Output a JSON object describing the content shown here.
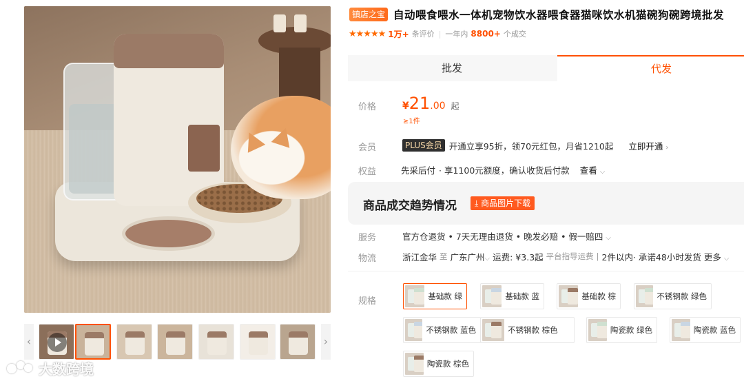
{
  "product": {
    "store_badge": "镇店之宝",
    "title": "自动喂食喂水一体机宠物饮水器喂食器猫咪饮水机猫碗狗碗跨境批发"
  },
  "rating": {
    "stars": "★★★★★",
    "reviews_count": "1万+",
    "reviews_label": "条评价",
    "sold_prefix": "一年内",
    "sold_count": "8800+",
    "sold_suffix": "个成交"
  },
  "tabs": [
    {
      "label": "批发",
      "active": false
    },
    {
      "label": "代发",
      "active": true
    }
  ],
  "price": {
    "label": "价格",
    "currency": "¥",
    "integer": "21",
    "decimal": ".00",
    "unit": "起",
    "moq": "≥1件"
  },
  "member": {
    "label": "会员",
    "badge": "PLUS会员",
    "text": "开通立享95折，领70元红包，月省1210起",
    "link": "立即开通",
    "link_chevron": "›"
  },
  "rights": {
    "label": "权益",
    "name": "先采后付",
    "text": "· 享1100元额度，确认收货后付款",
    "more": "查看",
    "more_chevron": "⌵"
  },
  "trend": {
    "title": "商品成交趋势情况",
    "button_icon": "⤓",
    "button": "商品图片下载"
  },
  "service": {
    "label": "服务",
    "text": "官方仓退货 • 7天无理由退货 • 晚发必赔 • 假一赔四",
    "chevron": "⌵"
  },
  "shipping": {
    "label": "物流",
    "from": "浙江金华",
    "to_word": "至",
    "to": "广东广州",
    "to_chevron": "⌵",
    "fee": "运费: ¥3.3起",
    "fee_note": "平台指导运费",
    "divider": "|",
    "time": "2件以内· 承诺48小时发货",
    "more": "更多",
    "more_chevron": "⌵"
  },
  "spec": {
    "label": "规格",
    "options": [
      {
        "name": "基础款 绿",
        "selected": true,
        "accent": "#cfe0d0"
      },
      {
        "name": "基础款 蓝",
        "selected": false,
        "accent": "#c9d6e3"
      },
      {
        "name": "基础款 棕",
        "selected": false,
        "accent": "#9b7a66"
      },
      {
        "name": "不锈钢款 绿色",
        "selected": false,
        "accent": "#cfe0d0"
      },
      {
        "name": "不锈钢款 蓝色",
        "selected": false,
        "accent": "#c9d6e3"
      },
      {
        "name": "不锈钢款 棕色",
        "selected": false,
        "accent": "#9b7a66"
      },
      {
        "name": "陶瓷款 绿色",
        "selected": false,
        "accent": "#cfe0d0"
      },
      {
        "name": "陶瓷款 蓝色",
        "selected": false,
        "accent": "#c9d6e3"
      },
      {
        "name": "陶瓷款 棕色",
        "selected": false,
        "accent": "#9b7a66"
      }
    ]
  },
  "gallery": {
    "prev_arrow": "‹",
    "next_arrow": "›",
    "thumbs": [
      {
        "kind": "video",
        "bg": "#8b6f5a"
      },
      {
        "kind": "image",
        "bg": "#c9b39b",
        "active": true
      },
      {
        "kind": "image",
        "bg": "#d8c7b2"
      },
      {
        "kind": "image",
        "bg": "#cbb59c"
      },
      {
        "kind": "image",
        "bg": "#e8e2d8"
      },
      {
        "kind": "image",
        "bg": "#f3eee7"
      },
      {
        "kind": "image",
        "bg": "#b9a58f"
      }
    ]
  },
  "watermark": "大数跨境",
  "colors": {
    "accent": "#ff5000",
    "badge": "#ff6a1a"
  }
}
